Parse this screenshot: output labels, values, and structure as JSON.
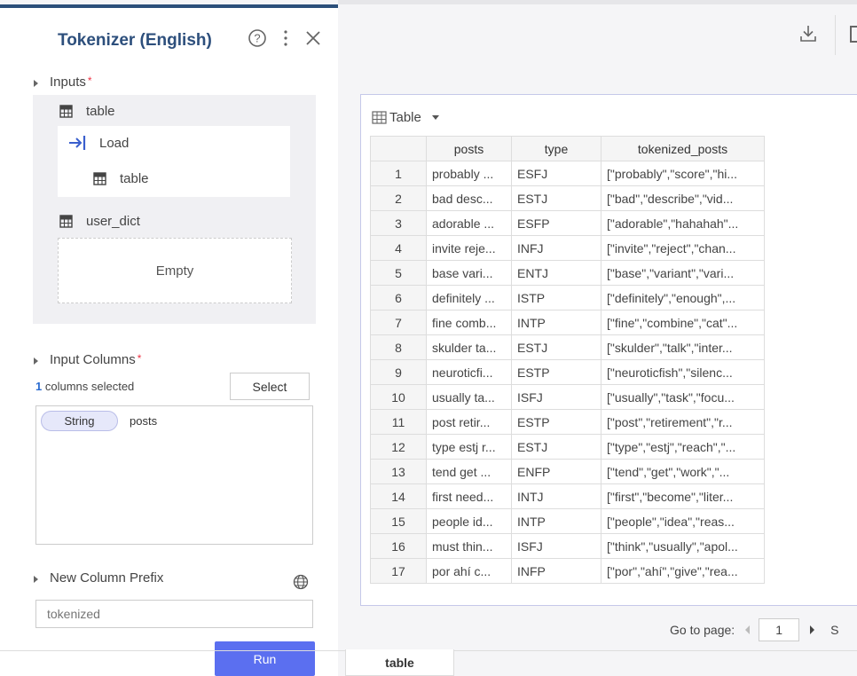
{
  "panel": {
    "title": "Tokenizer (English)",
    "inputs_label": "Inputs",
    "required_mark": "*",
    "input_table_label": "table",
    "load_label": "Load",
    "loaded_table_label": "table",
    "user_dict_label": "user_dict",
    "empty_label": "Empty",
    "input_columns_label": "Input Columns",
    "columns_selected_count": "1",
    "columns_selected_text": " columns selected",
    "select_label": "Select",
    "columns": [
      {
        "type": "String",
        "name": "posts"
      }
    ],
    "new_column_prefix_label": "New Column Prefix",
    "prefix_placeholder": "tokenized",
    "run_label": "Run"
  },
  "table_view": {
    "title": "Table",
    "columns": [
      "posts",
      "type",
      "tokenized_posts"
    ],
    "rows": [
      [
        "1",
        "probably ...",
        "ESFJ",
        "[\"probably\",\"score\",\"hi..."
      ],
      [
        "2",
        "bad desc...",
        "ESTJ",
        "[\"bad\",\"describe\",\"vid..."
      ],
      [
        "3",
        "adorable ...",
        "ESFP",
        "[\"adorable\",\"hahahah\"..."
      ],
      [
        "4",
        "invite reje...",
        "INFJ",
        "[\"invite\",\"reject\",\"chan..."
      ],
      [
        "5",
        "base vari...",
        "ENTJ",
        "[\"base\",\"variant\",\"vari..."
      ],
      [
        "6",
        "definitely ...",
        "ISTP",
        "[\"definitely\",\"enough\",..."
      ],
      [
        "7",
        "fine comb...",
        "INTP",
        "[\"fine\",\"combine\",\"cat\"..."
      ],
      [
        "8",
        "skulder ta...",
        "ESTJ",
        "[\"skulder\",\"talk\",\"inter..."
      ],
      [
        "9",
        "neuroticfi...",
        "ESTP",
        "[\"neuroticfish\",\"silenc..."
      ],
      [
        "10",
        "usually ta...",
        "ISFJ",
        "[\"usually\",\"task\",\"focu..."
      ],
      [
        "11",
        "post retir...",
        "ESTP",
        "[\"post\",\"retirement\",\"r..."
      ],
      [
        "12",
        "type estj r...",
        "ESTJ",
        "[\"type\",\"estj\",\"reach\",\"..."
      ],
      [
        "13",
        "tend get ...",
        "ENFP",
        "[\"tend\",\"get\",\"work\",\"..."
      ],
      [
        "14",
        "first need...",
        "INTJ",
        "[\"first\",\"become\",\"liter..."
      ],
      [
        "15",
        "people id...",
        "INTP",
        "[\"people\",\"idea\",\"reas..."
      ],
      [
        "16",
        "must thin...",
        "ISFJ",
        "[\"think\",\"usually\",\"apol..."
      ],
      [
        "17",
        "por ahí c...",
        "INFP",
        "[\"por\",\"ahí\",\"give\",\"rea..."
      ]
    ],
    "pager_label": "Go to page:",
    "page": "1",
    "pager_suffix": "S"
  },
  "bottom_tab": "table",
  "icons": {
    "help": "help-circle-icon",
    "more": "more-vertical-icon",
    "close": "close-icon",
    "download": "download-icon",
    "table": "table-grid-icon",
    "load": "arrow-right-into-icon",
    "globe": "globe-icon"
  },
  "colors": {
    "title": "#2d4f7c",
    "accent": "#5b6ff0",
    "required": "#e34",
    "pill_bg": "#e6e8fa"
  }
}
